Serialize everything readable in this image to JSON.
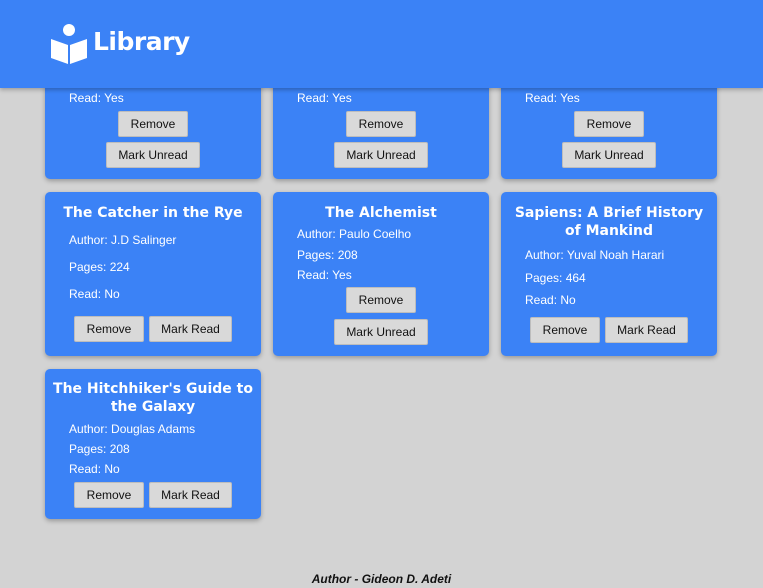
{
  "header": {
    "title": "Library"
  },
  "labels": {
    "author_prefix": "Author: ",
    "pages_prefix": "Pages: ",
    "read_prefix": "Read: ",
    "remove": "Remove",
    "mark_read": "Mark Read",
    "mark_unread": "Mark Unread"
  },
  "books": [
    {
      "read": "Yes"
    },
    {
      "read": "Yes"
    },
    {
      "read": "Yes"
    },
    {
      "title": "The Catcher in the Rye",
      "author": "J.D Salinger",
      "pages": "224",
      "read": "No"
    },
    {
      "title": "The Alchemist",
      "author": "Paulo Coelho",
      "pages": "208",
      "read": "Yes"
    },
    {
      "title": "Sapiens: A Brief History of Mankind",
      "author": "Yuval Noah Harari",
      "pages": "464",
      "read": "No"
    },
    {
      "title": "The Hitchhiker's Guide to the Galaxy",
      "author": "Douglas Adams",
      "pages": "208",
      "read": "No"
    }
  ],
  "footer": {
    "text": "Author - Gideon D. Adeti"
  },
  "colors": {
    "accent": "#3b82f6",
    "background": "#d3d3d3",
    "button": "#d9d9d9"
  }
}
